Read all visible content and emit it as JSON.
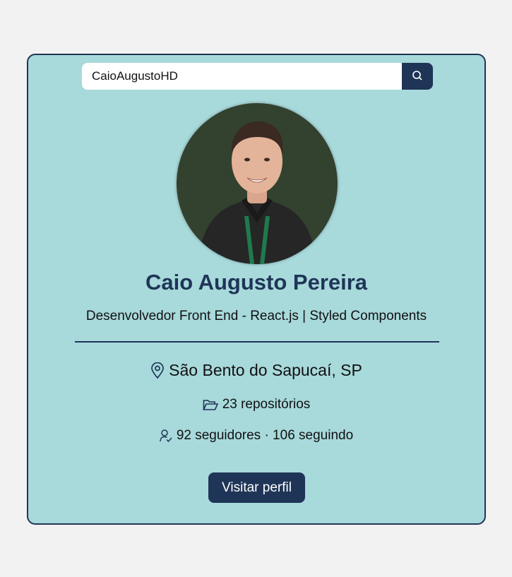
{
  "search": {
    "value": "CaioAugustoHD",
    "icon": "search-icon"
  },
  "profile": {
    "avatar_alt": "profile-photo",
    "name": "Caio Augusto Pereira",
    "bio": "Desenvolvedor Front End - React.js | Styled Components",
    "location": "São Bento do Sapucaí, SP",
    "repos_text": "23 repositórios",
    "followers_text": "92 seguidores · 106 seguindo"
  },
  "actions": {
    "visit_label": "Visitar perfil"
  },
  "colors": {
    "page_bg": "#f2f2f2",
    "card_bg": "#a8d9db",
    "accent": "#1f3557"
  },
  "icons": {
    "location": "map-pin-icon",
    "repos": "folder-open-icon",
    "followers": "user-check-icon"
  }
}
